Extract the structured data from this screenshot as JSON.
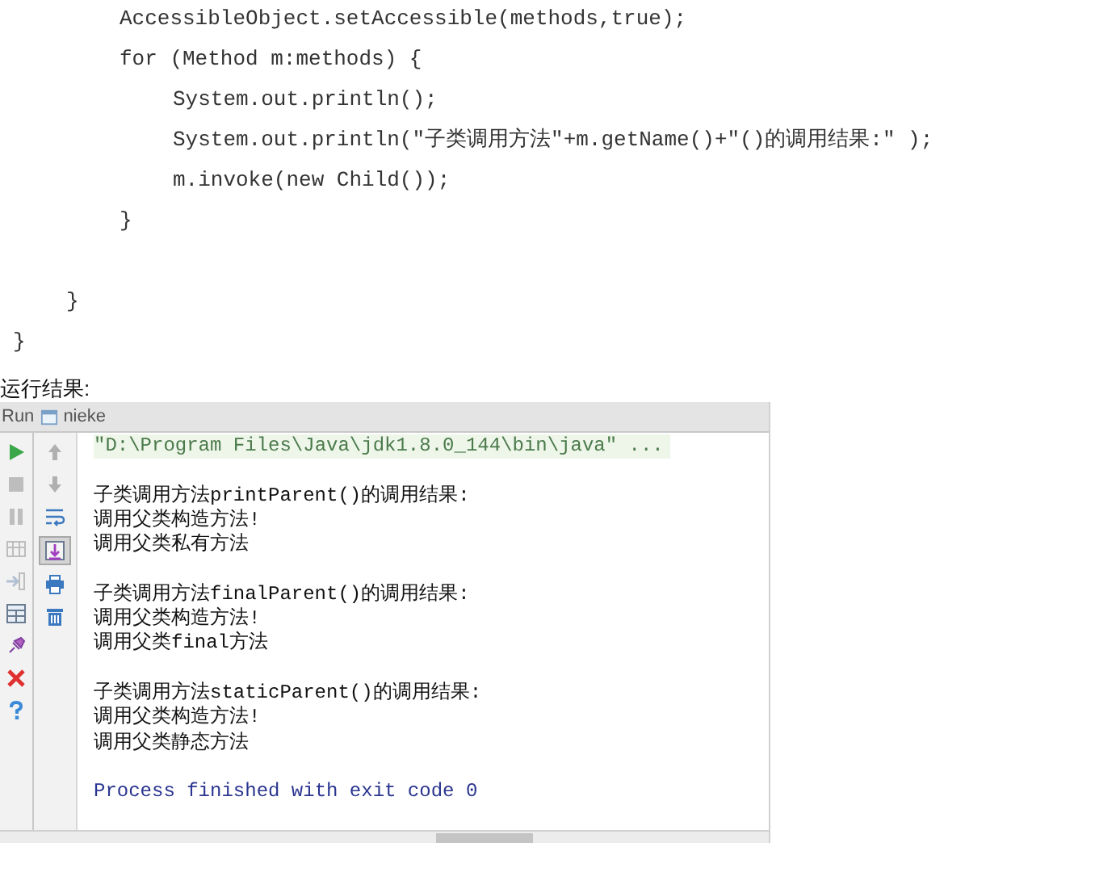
{
  "code": {
    "lines": [
      {
        "children": [
          {
            "children": [
              {
                "text": "AccessibleObject.setAccessible(methods,true);"
              },
              {
                "text": "for (Method m:methods) {",
                "children": [
                  {
                    "text": "System.out.println();"
                  },
                  {
                    "text": "System.out.println(\"子类调用方法\"+m.getName()+\"()的调用结果:\" );"
                  },
                  {
                    "text": "m.invoke(new Child());"
                  }
                ]
              },
              {
                "text": "}"
              }
            ]
          },
          {
            "text": "}"
          }
        ]
      },
      {
        "text": "}"
      }
    ]
  },
  "caption": "运行结果:",
  "run_panel": {
    "label": "Run",
    "config": "nieke",
    "left_toolbar": [
      {
        "kind": "run",
        "disabled": false
      },
      {
        "kind": "stop",
        "disabled": true
      },
      {
        "kind": "pause",
        "disabled": true
      },
      {
        "kind": "dump",
        "disabled": true
      },
      {
        "kind": "exit",
        "disabled": true
      },
      {
        "kind": "layout",
        "disabled": false
      },
      {
        "kind": "pin",
        "disabled": false
      },
      {
        "kind": "close",
        "disabled": false
      },
      {
        "kind": "help",
        "disabled": false
      }
    ],
    "right_toolbar": [
      {
        "kind": "up",
        "on": false
      },
      {
        "kind": "down",
        "on": false
      },
      {
        "kind": "wrap",
        "on": false
      },
      {
        "kind": "scroll-end",
        "on": true
      },
      {
        "kind": "print",
        "on": false
      },
      {
        "kind": "trash",
        "on": false
      }
    ],
    "command": "\"D:\\Program Files\\Java\\jdk1.8.0_144\\bin\\java\" ...",
    "groups": [
      [
        "子类调用方法printParent()的调用结果:",
        "调用父类构造方法!",
        "调用父类私有方法"
      ],
      [
        "子类调用方法finalParent()的调用结果:",
        "调用父类构造方法!",
        "调用父类final方法"
      ],
      [
        "子类调用方法staticParent()的调用结果:",
        "调用父类构造方法!",
        "调用父类静态方法"
      ]
    ],
    "exit_message": "Process finished with exit code 0"
  }
}
